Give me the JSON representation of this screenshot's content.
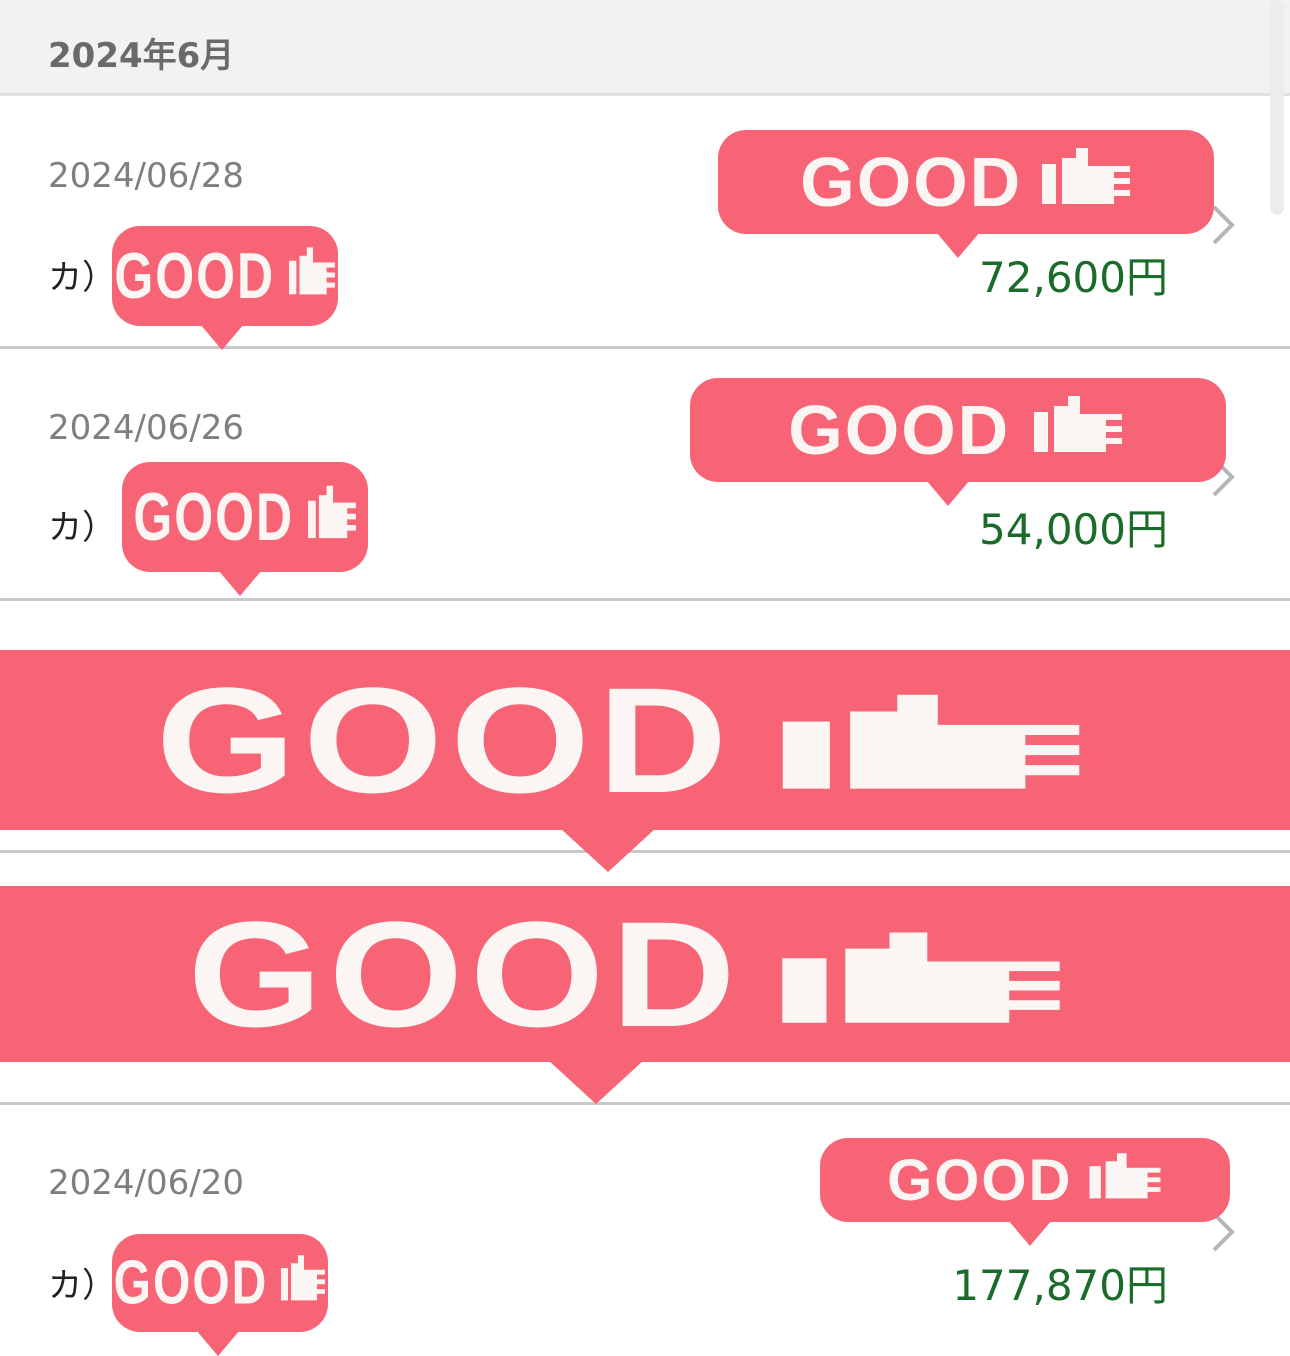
{
  "header": {
    "month": "2024年6月"
  },
  "transactions": [
    {
      "date": "2024/06/28",
      "payee": "カ）",
      "amount": "72,600円"
    },
    {
      "date": "2024/06/26",
      "payee": "カ）",
      "amount": "54,000円"
    },
    {
      "date": "2024/06/20",
      "payee": "カ）",
      "amount": "177,870円"
    }
  ],
  "sticker": {
    "text": "GOOD",
    "icon": "thumbs-up-icon",
    "color": "#f76476"
  },
  "colors": {
    "amount": "#1b6b2a",
    "date": "#7f7f7f",
    "divider": "#c9c9c9"
  }
}
